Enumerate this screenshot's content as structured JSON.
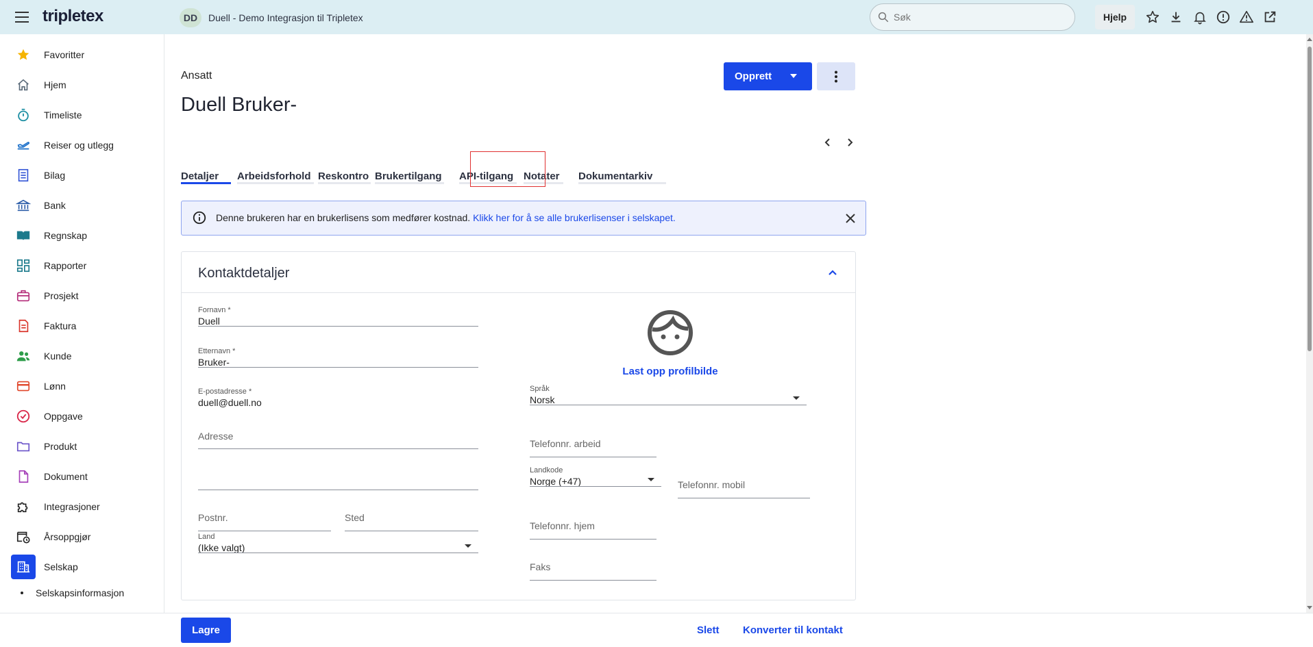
{
  "topbar": {
    "logo": "tripletex",
    "company_initials": "DD",
    "company_name": "Duell - Demo Integrasjon til Tripletex",
    "search_placeholder": "Søk",
    "help_label": "Hjelp",
    "icons": [
      "star-icon",
      "download-icon",
      "bell-icon",
      "alert-circle-icon",
      "warning-icon",
      "external-link-icon"
    ]
  },
  "sidebar": {
    "items": [
      {
        "label": "Favoritter",
        "icon": "star-icon",
        "color": "#f5b400"
      },
      {
        "label": "Hjem",
        "icon": "home-icon",
        "color": "#5b6b7a"
      },
      {
        "label": "Timeliste",
        "icon": "stopwatch-icon",
        "color": "#1e8fa3"
      },
      {
        "label": "Reiser og utlegg",
        "icon": "plane-icon",
        "color": "#1a6fc9"
      },
      {
        "label": "Bilag",
        "icon": "document-list-icon",
        "color": "#3557d6"
      },
      {
        "label": "Bank",
        "icon": "bank-icon",
        "color": "#2d5ea8"
      },
      {
        "label": "Regnskap",
        "icon": "book-icon",
        "color": "#1c7a8c"
      },
      {
        "label": "Rapporter",
        "icon": "dashboard-icon",
        "color": "#1c7a8c"
      },
      {
        "label": "Prosjekt",
        "icon": "briefcase-icon",
        "color": "#b42d7a"
      },
      {
        "label": "Faktura",
        "icon": "invoice-icon",
        "color": "#d9352b"
      },
      {
        "label": "Kunde",
        "icon": "people-icon",
        "color": "#2e9d4a"
      },
      {
        "label": "Lønn",
        "icon": "card-icon",
        "color": "#e0462a"
      },
      {
        "label": "Oppgave",
        "icon": "check-circle-icon",
        "color": "#d9284a"
      },
      {
        "label": "Produkt",
        "icon": "folder-icon",
        "color": "#6a53c9"
      },
      {
        "label": "Dokument",
        "icon": "file-icon",
        "color": "#a53fb8"
      },
      {
        "label": "Integrasjoner",
        "icon": "puzzle-icon",
        "color": "#222222"
      },
      {
        "label": "Årsoppgjør",
        "icon": "calendar-clock-icon",
        "color": "#222222"
      },
      {
        "label": "Selskap",
        "icon": "building-icon",
        "color": "#ffffff"
      }
    ],
    "sub_item": "Selskapsinformasjon"
  },
  "page": {
    "breadcrumb": "Ansatt",
    "title": "Duell Bruker-",
    "create_label": "Opprett",
    "tabs": [
      "Detaljer",
      "Arbeidsforhold",
      "Reskontro",
      "Brukertilgang",
      "API-tilgang",
      "Notater",
      "Dokumentarkiv"
    ],
    "active_tab": "Detaljer",
    "alert_text": "Denne brukeren har en brukerlisens som medfører kostnad.",
    "alert_link": "Klikk her for å se alle brukerlisenser i selskapet."
  },
  "contact": {
    "section_title": "Kontaktdetaljer",
    "first_name_label": "Fornavn *",
    "first_name": "Duell",
    "last_name_label": "Etternavn *",
    "last_name": "Bruker-",
    "email_label": "E-postadresse *",
    "email": "duell@duell.no",
    "address_placeholder": "Adresse",
    "postal_placeholder": "Postnr.",
    "city_placeholder": "Sted",
    "country_label": "Land",
    "country": "(Ikke valgt)",
    "upload_label": "Last opp profilbilde",
    "language_label": "Språk",
    "language": "Norsk",
    "work_phone_placeholder": "Telefonnr. arbeid",
    "country_code_label": "Landkode",
    "country_code": "Norge (+47)",
    "mobile_placeholder": "Telefonnr. mobil",
    "home_phone_placeholder": "Telefonnr. hjem",
    "fax_placeholder": "Faks"
  },
  "bottom": {
    "save_label": "Lagre",
    "delete_label": "Slett",
    "convert_label": "Konverter til kontakt"
  },
  "colors": {
    "accent": "#1a48e8",
    "topbar_bg": "#dceef3",
    "highlight": "#e03030"
  }
}
